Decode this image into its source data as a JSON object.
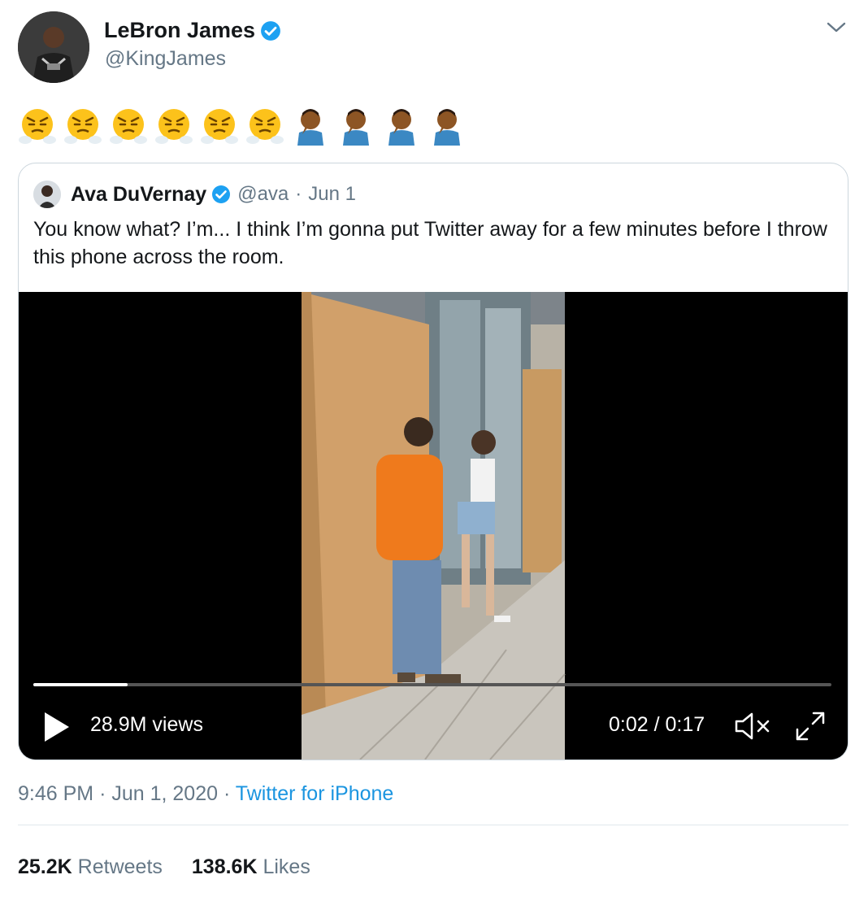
{
  "author": {
    "display_name": "LeBron James",
    "handle": "@KingJames",
    "verified": true,
    "avatar": "player-photo-avatar"
  },
  "tweet": {
    "emojis": [
      "face-with-steam-from-nose",
      "face-with-steam-from-nose",
      "face-with-steam-from-nose",
      "face-with-steam-from-nose",
      "face-with-steam-from-nose",
      "face-with-steam-from-nose",
      "man-facepalming",
      "man-facepalming",
      "man-facepalming",
      "man-facepalming"
    ]
  },
  "quoted_tweet": {
    "display_name": "Ava DuVernay",
    "handle": "@ava",
    "separator": "·",
    "date": "Jun 1",
    "verified": true,
    "text": "You know what? I’m... I think I’m gonna put Twitter away for a few minutes before I throw this phone across the room.",
    "video": {
      "views": "28.9M views",
      "time": "0:02 / 0:17",
      "progress": 0.118,
      "muted": true
    }
  },
  "meta": {
    "time": "9:46 PM",
    "sep1": "·",
    "date": "Jun 1, 2020",
    "sep2": "·",
    "source": "Twitter for iPhone"
  },
  "stats": {
    "retweets_count": "25.2K",
    "retweets_label": "Retweets",
    "likes_count": "138.6K",
    "likes_label": "Likes"
  },
  "colors": {
    "link": "#1b95e0",
    "verified": "#1da1f2",
    "secondary_text": "#657786",
    "border": "#ccd6dd"
  }
}
